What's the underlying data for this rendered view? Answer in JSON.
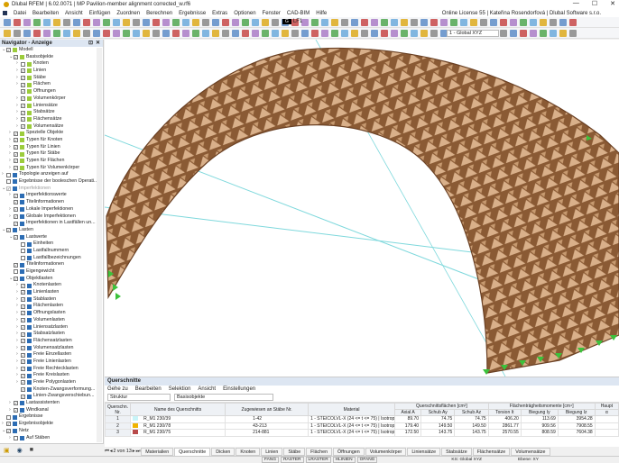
{
  "window": {
    "title": "Dlubal RFEM | 6.02.0071 | MP Pavilion-member alignment corrected_w.rf6",
    "license": "Online License 55 | Kateřina Rosendorfová | Dlubal Software s.r.o.",
    "min": "—",
    "max": "☐",
    "close": "✕"
  },
  "menu": [
    "Datei",
    "Bearbeiten",
    "Ansicht",
    "Einfügen",
    "Zuordnen",
    "Berechnen",
    "Ergebnisse",
    "Extras",
    "Optionen",
    "Fenster",
    "CAD-BIM",
    "Hilfe"
  ],
  "toolbar": {
    "lf_color": "G",
    "lf_label": "LF1",
    "coord_system": "1 - Global XYZ"
  },
  "navigator": {
    "title": "Navigator - Anzeige",
    "pin": "⊡",
    "close": "✕",
    "items": [
      {
        "l": 0,
        "e": "v",
        "c": "x",
        "t": "Modell"
      },
      {
        "l": 1,
        "e": "v",
        "c": "x",
        "t": "Basisobjekte"
      },
      {
        "l": 2,
        "e": ">",
        "c": "",
        "t": "Knoten"
      },
      {
        "l": 2,
        "e": ">",
        "c": "x",
        "t": "Linien"
      },
      {
        "l": 2,
        "e": ">",
        "c": "x",
        "t": "Stäbe"
      },
      {
        "l": 2,
        "e": ">",
        "c": "x",
        "t": "Flächen"
      },
      {
        "l": 2,
        "e": "",
        "c": "x",
        "t": "Öffnungen"
      },
      {
        "l": 2,
        "e": ">",
        "c": "x",
        "t": "Volumenkörper"
      },
      {
        "l": 2,
        "e": ">",
        "c": "x",
        "t": "Liniensätze"
      },
      {
        "l": 2,
        "e": ">",
        "c": "x",
        "t": "Stabsätze"
      },
      {
        "l": 2,
        "e": ">",
        "c": "x",
        "t": "Flächensätze"
      },
      {
        "l": 2,
        "e": ">",
        "c": "x",
        "t": "Volumensätze"
      },
      {
        "l": 1,
        "e": ">",
        "c": "x",
        "t": "Spezielle Objekte"
      },
      {
        "l": 1,
        "e": ">",
        "c": "x",
        "t": "Typen für Knoten"
      },
      {
        "l": 1,
        "e": ">",
        "c": "x",
        "t": "Typen für Linien"
      },
      {
        "l": 1,
        "e": ">",
        "c": "x",
        "t": "Typen für Stäbe"
      },
      {
        "l": 1,
        "e": ">",
        "c": "x",
        "t": "Typen für Flächen"
      },
      {
        "l": 1,
        "e": ">",
        "c": "x",
        "t": "Typen für Volumenkörper"
      },
      {
        "l": 0,
        "e": ">",
        "c": "",
        "t": "Topologie anzeigen auf"
      },
      {
        "l": 0,
        "e": "",
        "c": "",
        "t": "Ergebnisse der booleschen Operati..."
      },
      {
        "l": 0,
        "e": "v",
        "c": "g",
        "t": "Imperfektionen"
      },
      {
        "l": 1,
        "e": ">",
        "c": "x",
        "t": "Imperfektionswerte"
      },
      {
        "l": 1,
        "e": "",
        "c": "x",
        "t": "Titelinformationen"
      },
      {
        "l": 1,
        "e": ">",
        "c": "x",
        "t": "Lokale Imperfektionen"
      },
      {
        "l": 1,
        "e": ">",
        "c": "x",
        "t": "Globale Imperfektionen"
      },
      {
        "l": 1,
        "e": "",
        "c": "x",
        "t": "Imperfektionen in Lastfällen un..."
      },
      {
        "l": 0,
        "e": "v",
        "c": "x",
        "t": "Lasten"
      },
      {
        "l": 1,
        "e": "v",
        "c": "x",
        "t": "Lastwerte"
      },
      {
        "l": 2,
        "e": "",
        "c": "",
        "t": "Einheiten"
      },
      {
        "l": 2,
        "e": "",
        "c": "",
        "t": "Lastfallnummern"
      },
      {
        "l": 2,
        "e": "",
        "c": "",
        "t": "Lastfallbezeichnungen"
      },
      {
        "l": 1,
        "e": "",
        "c": "x",
        "t": "Titelinformationen"
      },
      {
        "l": 1,
        "e": "",
        "c": "",
        "t": "Eigengewicht"
      },
      {
        "l": 1,
        "e": "v",
        "c": "x",
        "t": "Objektlasten"
      },
      {
        "l": 2,
        "e": ">",
        "c": "x",
        "t": "Knotenlasten"
      },
      {
        "l": 2,
        "e": ">",
        "c": "x",
        "t": "Linienlasten"
      },
      {
        "l": 2,
        "e": ">",
        "c": "x",
        "t": "Stablasten"
      },
      {
        "l": 2,
        "e": ">",
        "c": "x",
        "t": "Flächenlasten"
      },
      {
        "l": 2,
        "e": ">",
        "c": "x",
        "t": "Öffnungslasten"
      },
      {
        "l": 2,
        "e": ">",
        "c": "x",
        "t": "Volumenlasten"
      },
      {
        "l": 2,
        "e": ">",
        "c": "x",
        "t": "Liniensatzlasten"
      },
      {
        "l": 2,
        "e": ">",
        "c": "x",
        "t": "Stabsatzlasten"
      },
      {
        "l": 2,
        "e": ">",
        "c": "x",
        "t": "Flächensatzlasten"
      },
      {
        "l": 2,
        "e": ">",
        "c": "x",
        "t": "Volumensatzlasten"
      },
      {
        "l": 2,
        "e": ">",
        "c": "x",
        "t": "Freie Einzellasten"
      },
      {
        "l": 2,
        "e": ">",
        "c": "x",
        "t": "Freie Linienlasten"
      },
      {
        "l": 2,
        "e": ">",
        "c": "x",
        "t": "Freie Rechtecklasten"
      },
      {
        "l": 2,
        "e": ">",
        "c": "x",
        "t": "Freie Kreislasten"
      },
      {
        "l": 2,
        "e": ">",
        "c": "x",
        "t": "Freie Polygonlasten"
      },
      {
        "l": 2,
        "e": "",
        "c": "x",
        "t": "Knoten-Zwangsverformung..."
      },
      {
        "l": 2,
        "e": "",
        "c": "x",
        "t": "Linien-Zwangsverschiebun..."
      },
      {
        "l": 1,
        "e": ">",
        "c": "x",
        "t": "Lastassistenten"
      },
      {
        "l": 1,
        "e": ">",
        "c": "x",
        "t": "Windkanal"
      },
      {
        "l": 0,
        "e": "",
        "c": "",
        "t": "Ergebnisse"
      },
      {
        "l": 0,
        "e": ">",
        "c": "x",
        "t": "Ergebnisobjekte"
      },
      {
        "l": 0,
        "e": "v",
        "c": "x",
        "t": "Netz"
      },
      {
        "l": 1,
        "e": ">",
        "c": "",
        "t": "Auf Stäben"
      }
    ]
  },
  "panel": {
    "title": "Querschnitte",
    "menu": [
      "Gehe zu",
      "Bearbeiten",
      "Selektion",
      "Ansicht",
      "Einstellungen"
    ],
    "filter1": "Struktur",
    "filter2": "Basisobjekte",
    "group_headers": {
      "areas": "Querschnittsflächen [cm²]",
      "moments": "Flächenträgheitsmomente [cm⁴]",
      "main": "Haupt"
    },
    "columns": [
      "Querschn. Nr.",
      "Name des Querschnitts",
      "Zugewiesen an Stäbe Nr.",
      "Material",
      "Axial A",
      "Schub Ay",
      "Schub Az",
      "Torsion It",
      "Biegung Iy",
      "Biegung Iz",
      "α"
    ],
    "rows": [
      {
        "nr": "1",
        "color": "#c8f4f8",
        "name": "R_M1 230/39",
        "members": "1-42",
        "material": "1 - STEICOLVL-X (24 <= t <= 75) | Isotrop | ...",
        "A": "89.70",
        "Ay": "74.75",
        "Az": "74.75",
        "It": "406.20",
        "Iy": "113.69",
        "Iz": "3954.28"
      },
      {
        "nr": "2",
        "color": "#f0b400",
        "name": "R_M1 230/78",
        "members": "43-213",
        "material": "1 - STEICOLVL-X (24 <= t <= 75) | Isotrop | ...",
        "A": "179.40",
        "Ay": "149.50",
        "Az": "149.50",
        "It": "2861.77",
        "Iy": "909.56",
        "Iz": "7908.55"
      },
      {
        "nr": "3",
        "color": "#b84a4a",
        "name": "R_M1 230/75",
        "members": "214-881",
        "material": "1 - STEICOLVL-X (24 <= t <= 75) | Isotrop | ...",
        "A": "172.50",
        "Ay": "143.75",
        "Az": "143.75",
        "It": "2570.55",
        "Iy": "808.59",
        "Iz": "7604.38"
      }
    ],
    "pager": "2 von 13",
    "tabs": [
      "Materialien",
      "Querschnitte",
      "Dicken",
      "Knoten",
      "Linien",
      "Stäbe",
      "Flächen",
      "Öffnungen",
      "Volumenkörper",
      "Liniensätze",
      "Stabsätze",
      "Flächensätze",
      "Volumensätze"
    ],
    "active_tab": "Querschnitte"
  },
  "status": {
    "toggles": [
      "FANG",
      "RASTER",
      "LRASTER",
      "HLINIEN",
      "OFANG"
    ],
    "cs": "KS: Global XYZ",
    "plane": "Ebene: XY"
  }
}
